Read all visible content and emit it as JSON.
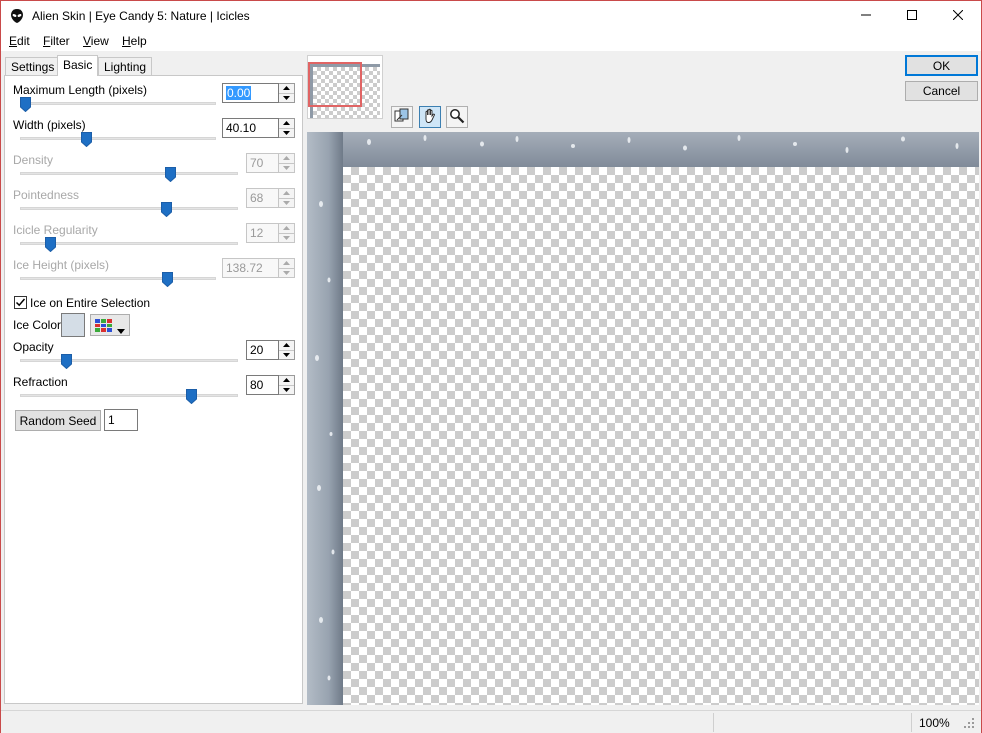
{
  "window": {
    "title": "Alien Skin | Eye Candy 5: Nature | Icicles"
  },
  "menu": {
    "items": [
      {
        "key": "E",
        "rest": "dit"
      },
      {
        "key": "F",
        "rest": "ilter"
      },
      {
        "key": "V",
        "rest": "iew"
      },
      {
        "key": "H",
        "rest": "elp"
      }
    ]
  },
  "tabs": [
    "Settings",
    "Basic",
    "Lighting"
  ],
  "controls": {
    "max_length": {
      "label": "Maximum Length (pixels)",
      "value": "0.00",
      "level": 0.0
    },
    "width": {
      "label": "Width (pixels)",
      "value": "40.10",
      "level": 0.33
    },
    "density": {
      "label": "Density",
      "value": "70",
      "level": 0.7
    },
    "pointedness": {
      "label": "Pointedness",
      "value": "68",
      "level": 0.68
    },
    "icicle_regularity": {
      "label": "Icicle Regularity",
      "value": "12",
      "level": 0.12
    },
    "ice_height": {
      "label": "Ice Height (pixels)",
      "value": "138.72",
      "level": 0.77
    },
    "ice_on_entire_selection": {
      "label": "Ice on Entire Selection",
      "checked": true
    },
    "ice_color": {
      "label": "Ice Color",
      "swatch": "#d4dde6"
    },
    "opacity": {
      "label": "Opacity",
      "value": "20",
      "level": 0.2
    },
    "refraction": {
      "label": "Refraction",
      "value": "80",
      "level": 0.8
    },
    "random_seed": {
      "label": "Random Seed",
      "value": "1"
    }
  },
  "buttons": {
    "ok": "OK",
    "cancel": "Cancel"
  },
  "status": {
    "zoom": "100%"
  },
  "colors": {
    "accent": "#0078d7",
    "thumb": "#1e6fc4",
    "frame": "#c94a4a"
  }
}
